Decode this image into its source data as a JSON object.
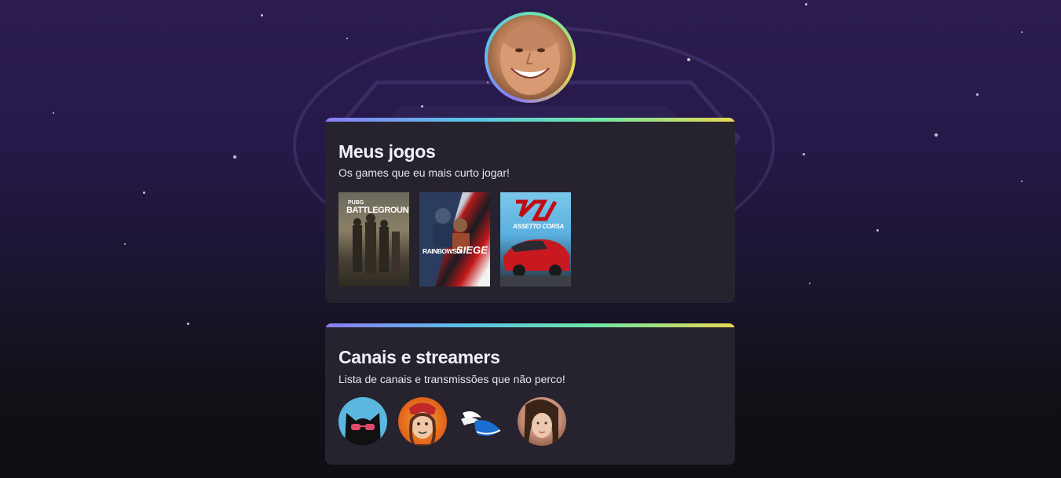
{
  "profile": {
    "avatar_icon": "profile-avatar-photo"
  },
  "sections": {
    "games": {
      "title": "Meus jogos",
      "subtitle": "Os games que eu mais curto jogar!",
      "items": [
        {
          "name": "BATTLEGROUNDS",
          "top_text": "PUBG",
          "icon": "pubg-cover"
        },
        {
          "name": "RAINBOWSIX",
          "top_text": "SIEGE",
          "icon": "rainbow-six-siege-cover"
        },
        {
          "name": "ASSETTO CORSA",
          "icon": "assetto-corsa-cover"
        }
      ]
    },
    "streamers": {
      "title": "Canais e streamers",
      "subtitle": "Lista de canais e transmissões que não perco!",
      "items": [
        {
          "icon": "cat-sunglasses-avatar"
        },
        {
          "icon": "cartoon-face-avatar"
        },
        {
          "icon": "winged-shoe-avatar"
        },
        {
          "icon": "woman-photo-avatar"
        }
      ]
    }
  },
  "colors": {
    "accent_gradient": [
      "#8b7cf6",
      "#59c3e8",
      "#6ee7a8",
      "#e8d84f"
    ],
    "card_bg": "#26232f"
  }
}
